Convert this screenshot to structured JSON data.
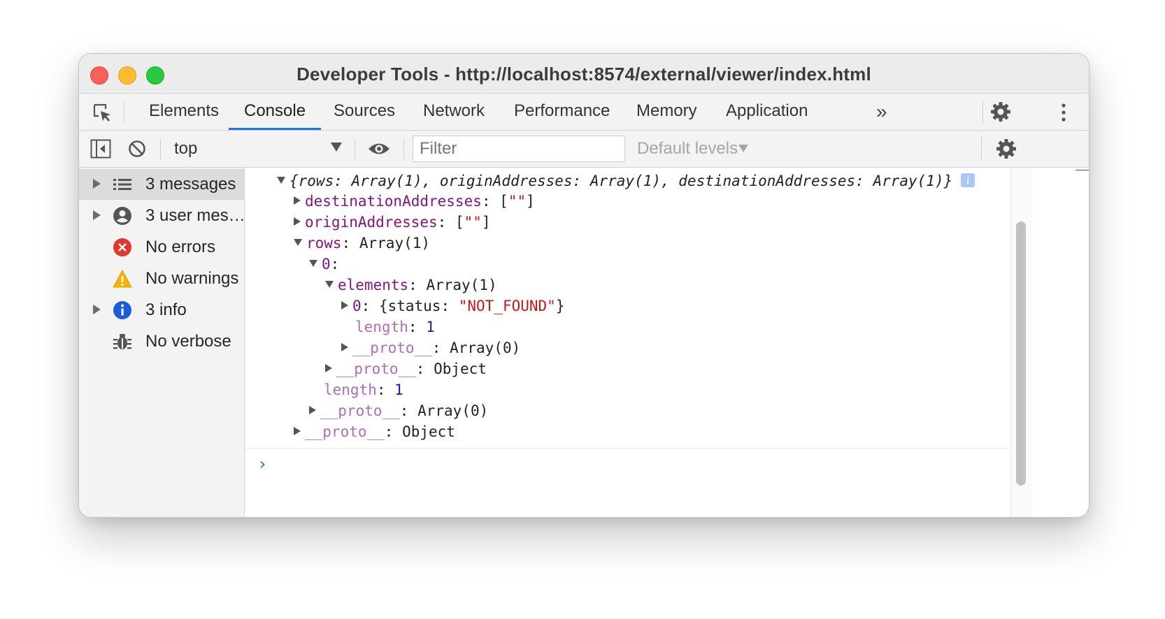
{
  "window": {
    "title": "Developer Tools - http://localhost:8574/external/viewer/index.html"
  },
  "tabs": [
    {
      "label": "Elements",
      "active": false
    },
    {
      "label": "Console",
      "active": true
    },
    {
      "label": "Sources",
      "active": false
    },
    {
      "label": "Network",
      "active": false
    },
    {
      "label": "Performance",
      "active": false
    },
    {
      "label": "Memory",
      "active": false
    },
    {
      "label": "Application",
      "active": false
    }
  ],
  "tabbar": {
    "more_label": "»"
  },
  "toolbar": {
    "context": "top",
    "filter_placeholder": "Filter",
    "levels": "Default levels"
  },
  "sidebar": {
    "items": [
      {
        "label": "3 messages",
        "icon": "list-icon",
        "expandable": true,
        "selected": true
      },
      {
        "label": "3 user mes…",
        "icon": "user-icon",
        "expandable": true,
        "selected": false
      },
      {
        "label": "No errors",
        "icon": "error-icon",
        "expandable": false,
        "selected": false
      },
      {
        "label": "No warnings",
        "icon": "warning-icon",
        "expandable": false,
        "selected": false
      },
      {
        "label": "3 info",
        "icon": "info-icon",
        "expandable": true,
        "selected": false
      },
      {
        "label": "No verbose",
        "icon": "bug-icon",
        "expandable": false,
        "selected": false
      }
    ]
  },
  "console": {
    "summary": "{rows: Array(1), originAddresses: Array(1), destinationAddresses: Array(1)}",
    "info_badge": "i",
    "tree": {
      "destinationAddresses_key": "destinationAddresses",
      "destinationAddresses_val": "\"\"",
      "originAddresses_key": "originAddresses",
      "originAddresses_val": "\"\"",
      "rows_key": "rows",
      "rows_val": "Array(1)",
      "zero_key": "0",
      "elements_key": "elements",
      "elements_val": "Array(1)",
      "elem0_key": "0",
      "elem0_status_key": "status",
      "elem0_status_val": "\"NOT_FOUND\"",
      "length_key": "length",
      "length_val": "1",
      "proto_key": "__proto__",
      "array0_val": "Array(0)",
      "object_val": "Object"
    },
    "prompt": "›"
  },
  "colors": {
    "accent": "#1a73e8",
    "property_key": "#881280",
    "string": "#c41a16",
    "number": "#1a1aa6"
  }
}
